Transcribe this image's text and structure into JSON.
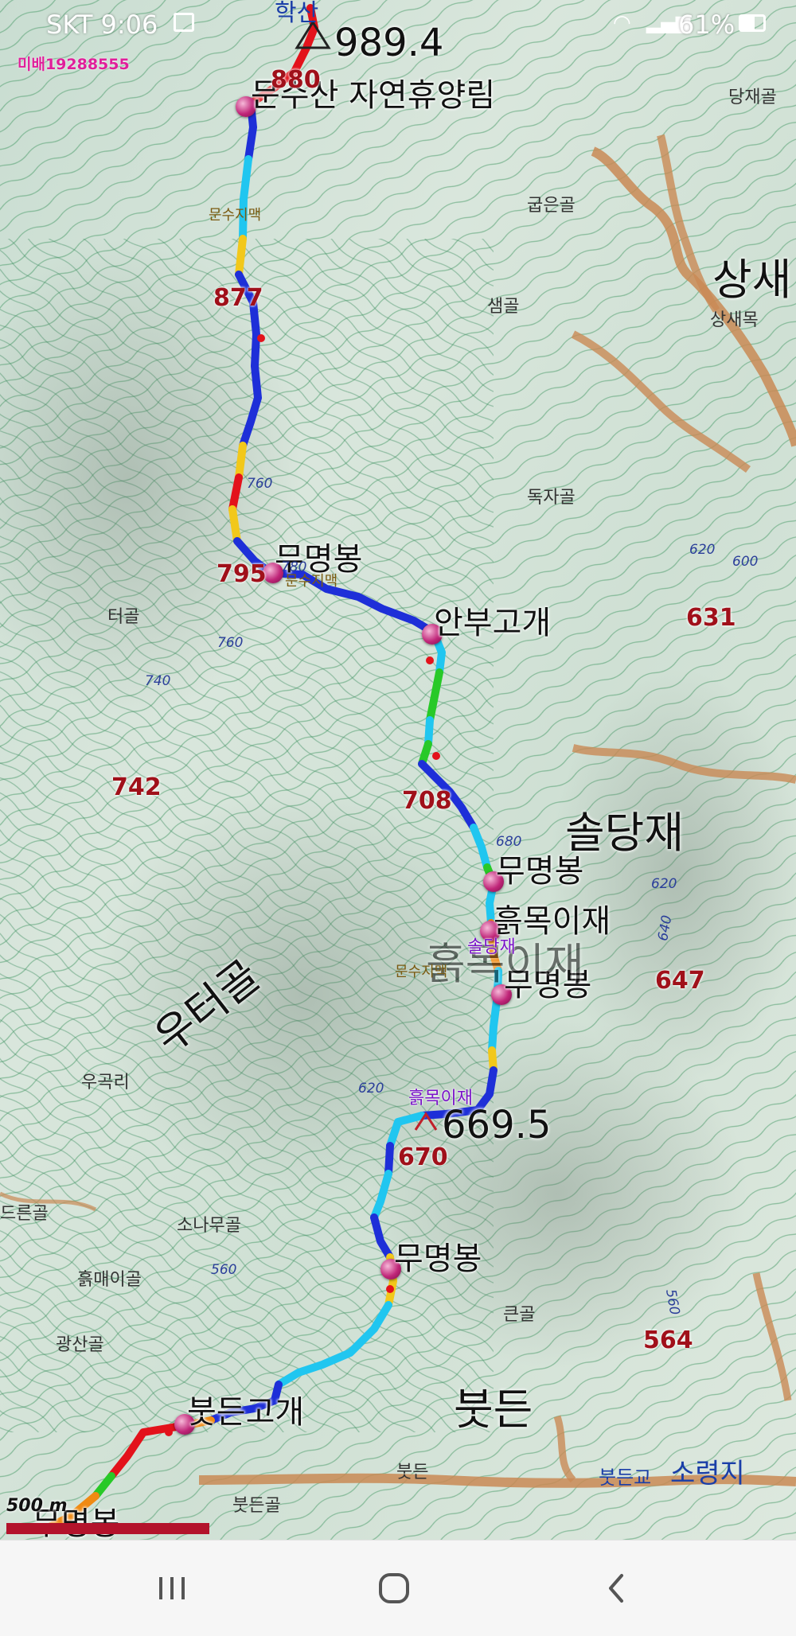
{
  "status_bar": {
    "carrier_time": "SKT 9:06",
    "battery": "61%"
  },
  "track_id": "미배19288555",
  "map": {
    "waypoints": [
      {
        "name": "문수산 자연휴양림"
      },
      {
        "name": "무명봉"
      },
      {
        "name": "안부고개"
      },
      {
        "name": "무명봉"
      },
      {
        "name": "흙목이재"
      },
      {
        "name": "무명봉"
      },
      {
        "name": "무명봉"
      },
      {
        "name": "붓든고개"
      },
      {
        "name": "무명봉"
      }
    ],
    "peaks": [
      "989.4",
      "669.5"
    ],
    "elevations": [
      "877",
      "795",
      "708",
      "670",
      "631",
      "742",
      "647",
      "564",
      "880"
    ],
    "top_label": "학산",
    "places": [
      "당재골",
      "굽은골",
      "샘골",
      "독자골",
      "터골",
      "상새목",
      "우곡리",
      "소나무골",
      "흙매이골",
      "광산골",
      "큰골",
      "붓든",
      "붓든골",
      "드른골"
    ],
    "big_places": [
      "상새",
      "솔당재",
      "붓든",
      "우터골",
      "흙목이재"
    ],
    "ridge_labels": [
      "문수지맥",
      "문수지맥",
      "문수지맥"
    ],
    "purple_labels": [
      "솔당재",
      "흙목이재"
    ],
    "blue_labels": [
      "붓든교",
      "소령지"
    ],
    "contours": [
      "760",
      "740",
      "760",
      "620",
      "600",
      "680",
      "620",
      "640",
      "620",
      "560",
      "560",
      "780"
    ]
  },
  "scale": {
    "label": "500 m"
  },
  "nav": {
    "recents_icon": "recent-apps-icon",
    "home_icon": "home-icon",
    "back_icon": "back-icon"
  },
  "colors": {
    "navbar": "#f6f6f6",
    "pin": "#c02679",
    "elevation_text": "#a0101a"
  }
}
